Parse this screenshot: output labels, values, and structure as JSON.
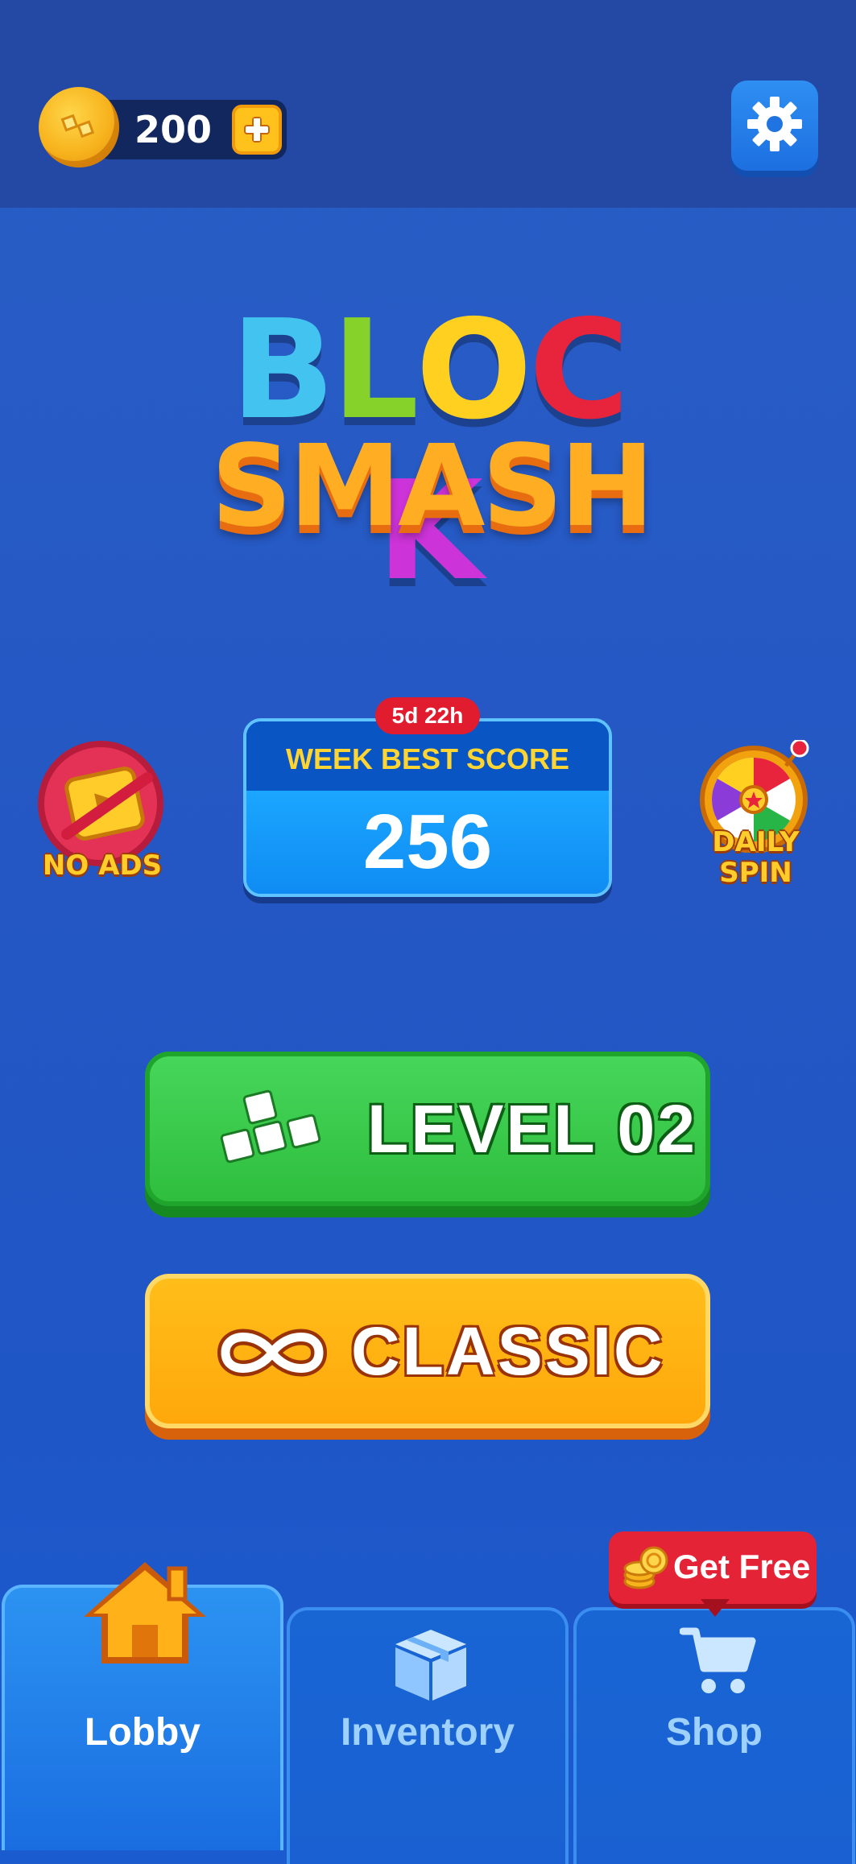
{
  "currency": {
    "coins": "200",
    "coin_icon": "coin-icon",
    "add_icon": "plus-icon"
  },
  "settings": {
    "icon": "gear-icon"
  },
  "logo": {
    "line1_letters": [
      "B",
      "L",
      "O",
      "C",
      "K"
    ],
    "line2": "SMASH",
    "colors": [
      "#43c4f0",
      "#86d12a",
      "#ffd01f",
      "#e8243c",
      "#cc33d8"
    ]
  },
  "no_ads": {
    "label": "NO ADS"
  },
  "week_best": {
    "timer": "5d 22h",
    "title": "WEEK BEST SCORE",
    "score": "256"
  },
  "daily_spin": {
    "label_line1": "DAILY",
    "label_line2": "SPIN"
  },
  "modes": {
    "level": {
      "label": "LEVEL 02",
      "icon": "blocks-icon"
    },
    "classic": {
      "label": "CLASSIC",
      "icon": "infinity-icon"
    }
  },
  "shop_promo": {
    "label": "Get Free",
    "icon": "coin-stack-icon"
  },
  "nav": {
    "lobby": {
      "label": "Lobby",
      "icon": "home-icon"
    },
    "inventory": {
      "label": "Inventory",
      "icon": "box-icon"
    },
    "shop": {
      "label": "Shop",
      "icon": "cart-icon"
    }
  }
}
